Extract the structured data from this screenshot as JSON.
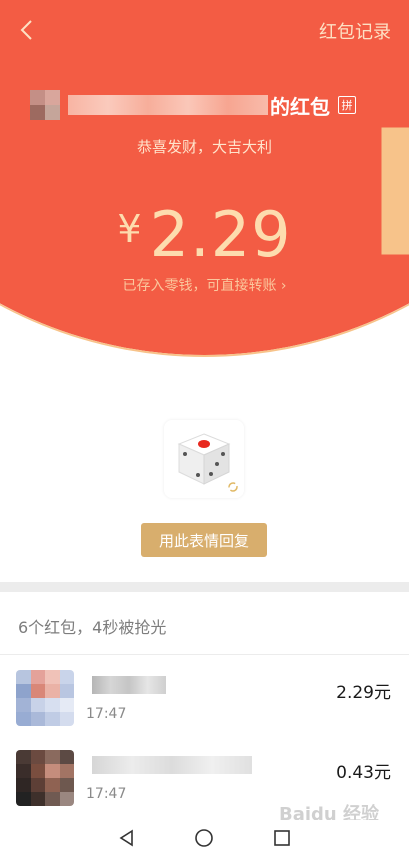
{
  "header": {
    "records_label": "红包记录",
    "sender_suffix": "的红包",
    "pin_badge": "拼",
    "wish": "恭喜发财，大吉大利",
    "currency": "¥",
    "amount": "2.29",
    "saved_note": "已存入零钱，可直接转账 ›",
    "colors": {
      "red": "#f35c44",
      "gold": "#fddcae"
    }
  },
  "sticker": {
    "icon": "dice-icon"
  },
  "reply_button": "用此表情回复",
  "list": {
    "summary": "6个红包，4秒被抢光",
    "rows": [
      {
        "time": "17:47",
        "amount": "2.29元"
      },
      {
        "time": "17:47",
        "amount": "0.43元"
      }
    ]
  },
  "watermark": "Baidu 经验"
}
